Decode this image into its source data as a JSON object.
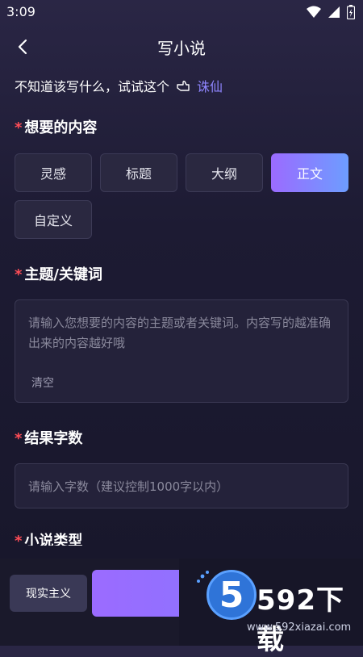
{
  "status_bar": {
    "time": "3:09"
  },
  "header": {
    "title": "写小说"
  },
  "hint": {
    "text": "不知道该写什么，试试这个",
    "suggestion": "诛仙"
  },
  "sections": {
    "content": {
      "label": "想要的内容"
    },
    "topic": {
      "label": "主题/关键词"
    },
    "count": {
      "label": "结果字数"
    },
    "novel_type": {
      "label": "小说类型"
    }
  },
  "content_options": [
    {
      "label": "灵感",
      "selected": false
    },
    {
      "label": "标题",
      "selected": false
    },
    {
      "label": "大纲",
      "selected": false
    },
    {
      "label": "正文",
      "selected": true
    },
    {
      "label": "自定义",
      "selected": false
    }
  ],
  "topic_input": {
    "placeholder": "请输入您想要的内容的主题或者关键词。内容写的越准确出来的内容越好哦",
    "clear_label": "清空"
  },
  "count_input": {
    "placeholder": "请输入字数（建议控制1000字以内）"
  },
  "bottom": {
    "type_button_label": "现实主义"
  },
  "watermark": {
    "brand": "592下载",
    "url": "www.592xiazai.com",
    "digit": "5"
  },
  "colors": {
    "accent_start": "#9b6bff",
    "accent_end": "#6d9dff",
    "required_star": "#ff4d57",
    "link": "#8f86ff"
  }
}
